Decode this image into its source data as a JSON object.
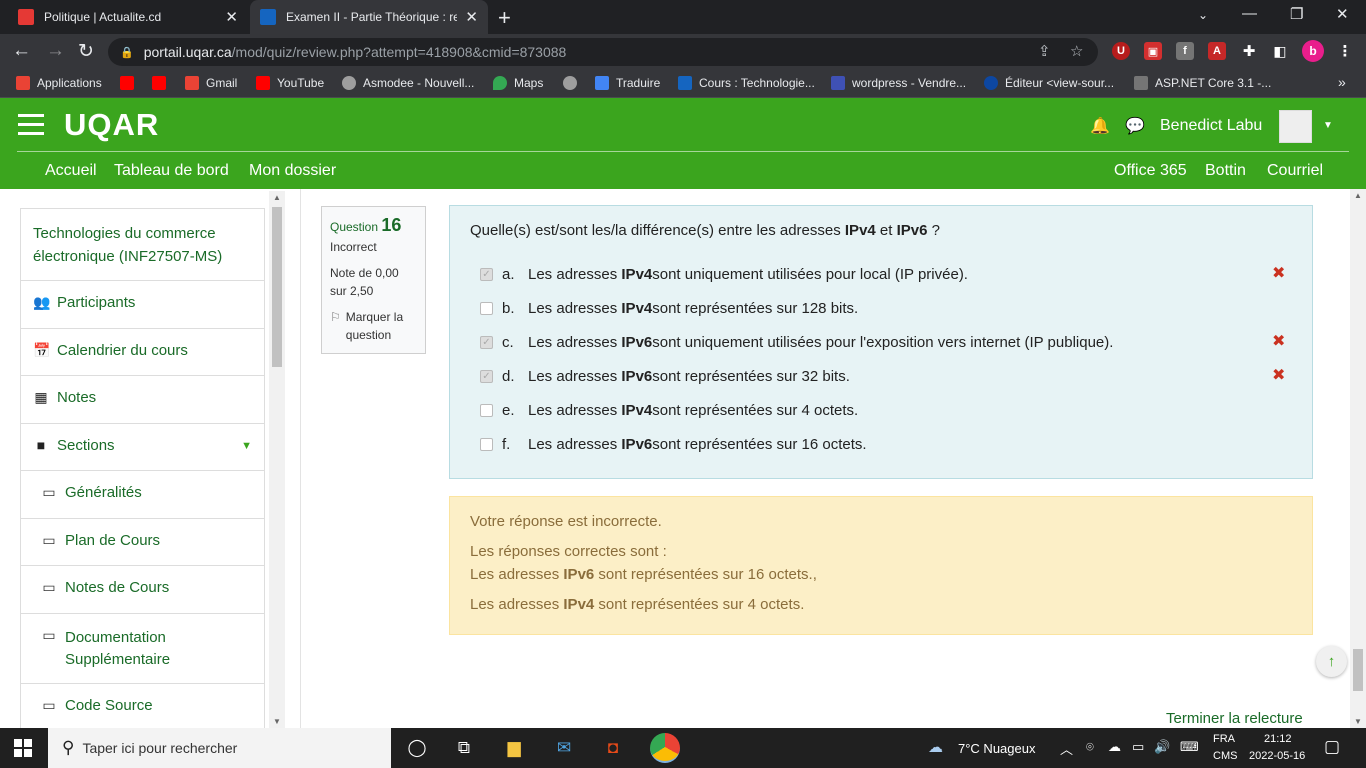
{
  "browser": {
    "tabs": [
      {
        "title": "Politique | Actualite.cd",
        "favicon_color": "#e53935",
        "active": false
      },
      {
        "title": "Examen II - Partie Théorique : rele",
        "favicon_color": "#1565c0",
        "active": true
      }
    ],
    "new_tab": "+",
    "url_host": "portail.uqar.ca",
    "url_path": "/mod/quiz/review.php?attempt=418908&cmid=873088",
    "profile_initial": "b",
    "bookmarks": [
      {
        "label": "Applications",
        "color": "#ea4335"
      },
      {
        "label": "",
        "color": "#ff0000"
      },
      {
        "label": "",
        "color": "#ff0000"
      },
      {
        "label": "Gmail",
        "color": "#ea4335"
      },
      {
        "label": "YouTube",
        "color": "#ff0000"
      },
      {
        "label": "Asmodee - Nouvell...",
        "color": "#9e9e9e"
      },
      {
        "label": "Maps",
        "color": "#34a853"
      },
      {
        "label": "",
        "color": "#9e9e9e"
      },
      {
        "label": "Traduire",
        "color": "#4285f4"
      },
      {
        "label": "Cours : Technologie...",
        "color": "#1565c0"
      },
      {
        "label": "wordpress - Vendre...",
        "color": "#3f51b5"
      },
      {
        "label": "Éditeur <view-sour...",
        "color": "#0d47a1"
      },
      {
        "label": "ASP.NET Core 3.1 -...",
        "color": "#757575"
      }
    ],
    "bookmarks_more": "»"
  },
  "site": {
    "logo": "UQAR",
    "user_name": "Benedict Labu",
    "nav_left": [
      "Accueil",
      "Tableau de bord",
      "Mon dossier"
    ],
    "nav_right": [
      "Office 365",
      "Bottin",
      "Courriel"
    ],
    "accent": "#3ba51e"
  },
  "sidebar": {
    "items": [
      {
        "label": "Technologies du commerce électronique (INF27507-MS)",
        "icon": ""
      },
      {
        "label": "Participants",
        "icon": "users-icon"
      },
      {
        "label": "Calendrier du cours",
        "icon": "calendar-icon"
      },
      {
        "label": "Notes",
        "icon": "table-icon"
      },
      {
        "label": "Sections",
        "icon": "folder-icon"
      }
    ],
    "sections": [
      {
        "label": "Généralités"
      },
      {
        "label": "Plan de Cours"
      },
      {
        "label": "Notes de Cours"
      },
      {
        "label": "Documentation Supplémentaire"
      },
      {
        "label": "Code Source"
      }
    ]
  },
  "question": {
    "label": "Question",
    "number": "16",
    "state": "Incorrect",
    "grade": "Note de 0,00 sur 2,50",
    "flag_label": "Marquer la question",
    "text_pre": "Quelle(s) est/sont les/la différence(s) entre les adresses ",
    "text_b1": "IPv4",
    "text_mid": " et ",
    "text_b2": "IPv6",
    "text_post": " ?",
    "options": [
      {
        "letter": "a.",
        "pre": "Les adresses ",
        "bold": "IPv4",
        "post": " sont uniquement utilisées pour local (IP privée).",
        "checked": true,
        "wrong": true
      },
      {
        "letter": "b.",
        "pre": "Les adresses ",
        "bold": "IPv4",
        "post": " sont représentées sur 128 bits.",
        "checked": false,
        "wrong": false
      },
      {
        "letter": "c.",
        "pre": "Les adresses ",
        "bold": "IPv6",
        "post": " sont uniquement utilisées pour l'exposition vers internet (IP publique).",
        "checked": true,
        "wrong": true
      },
      {
        "letter": "d.",
        "pre": "Les adresses ",
        "bold": "IPv6",
        "post": " sont représentées sur 32 bits.",
        "checked": true,
        "wrong": true
      },
      {
        "letter": "e.",
        "pre": "Les adresses ",
        "bold": "IPv4",
        "post": " sont représentées sur 4 octets.",
        "checked": false,
        "wrong": false
      },
      {
        "letter": "f.",
        "pre": "Les adresses ",
        "bold": "IPv6",
        "post": " sont représentées sur 16 octets.",
        "checked": false,
        "wrong": false
      }
    ]
  },
  "feedback": {
    "incorrect_msg": "Votre réponse est incorrecte.",
    "correct_intro": "Les réponses correctes sont :",
    "ans1_pre": "Les adresses ",
    "ans1_bold": "IPv6",
    "ans1_post": " sont représentées sur 16 octets.,",
    "ans2_pre": "Les adresses ",
    "ans2_bold": "IPv4",
    "ans2_post": " sont représentées sur 4 octets."
  },
  "finish_link": "Terminer la relecture",
  "taskbar": {
    "search_placeholder": "Taper ici pour rechercher",
    "weather": "7°C  Nuageux",
    "lang1": "FRA",
    "lang2": "CMS",
    "time": "21:12",
    "date": "2022-05-16"
  }
}
